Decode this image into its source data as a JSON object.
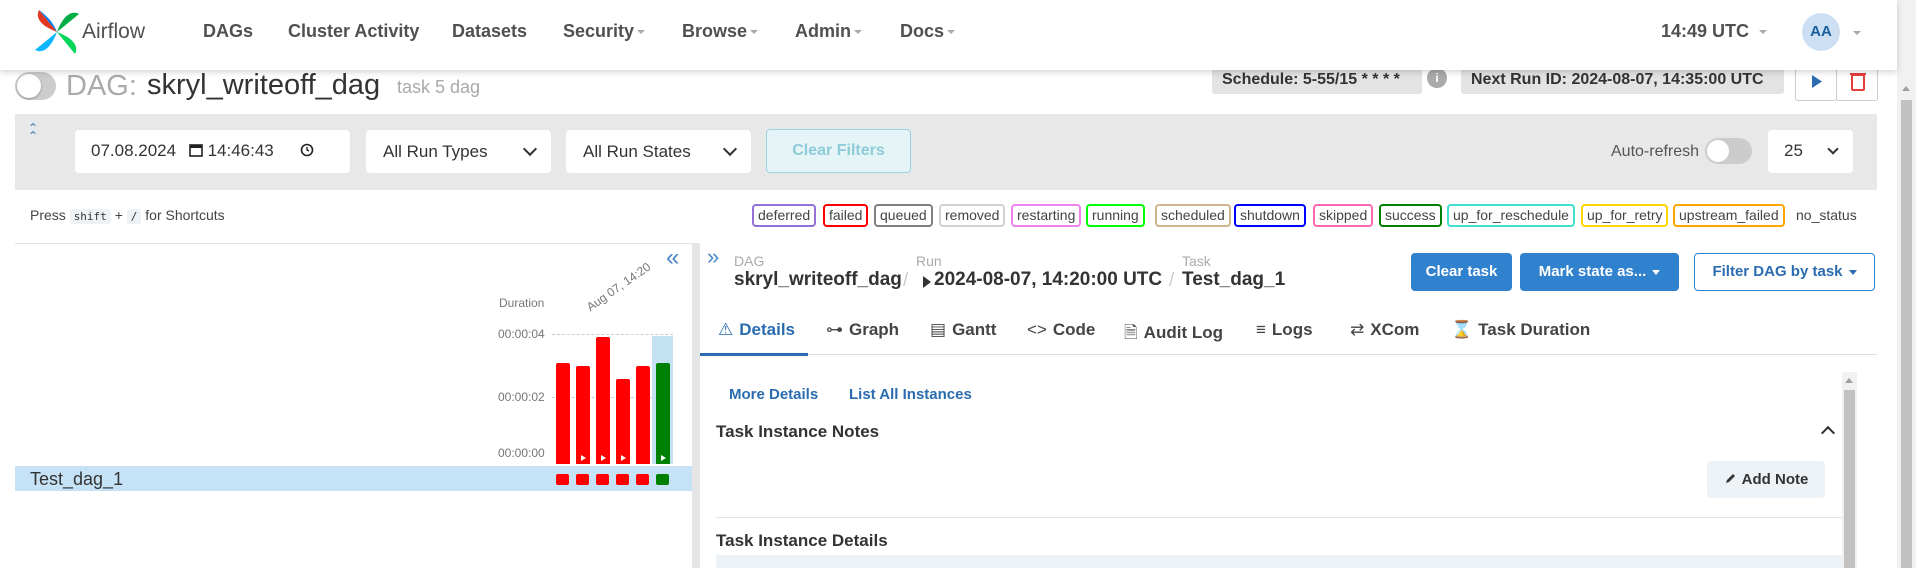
{
  "navbar": {
    "brand": "Airflow",
    "items": [
      {
        "label": "DAGs",
        "dropdown": false
      },
      {
        "label": "Cluster Activity",
        "dropdown": false
      },
      {
        "label": "Datasets",
        "dropdown": false
      },
      {
        "label": "Security",
        "dropdown": true
      },
      {
        "label": "Browse",
        "dropdown": true
      },
      {
        "label": "Admin",
        "dropdown": true
      },
      {
        "label": "Docs",
        "dropdown": true
      }
    ],
    "time": "14:49 UTC",
    "avatar": "AA"
  },
  "dag_header": {
    "prefix": "DAG:",
    "name": "skryl_writeoff_dag",
    "description": "task 5 dag",
    "schedule": "Schedule: 5-55/15 * * * *",
    "schedule_info_icon": "i",
    "next_run": "Next Run ID: 2024-08-07, 14:35:00 UTC",
    "is_paused": true
  },
  "filters": {
    "date": "07.08.2024",
    "time": "14:46:43",
    "run_types": "All Run Types",
    "run_states": "All Run States",
    "clear_filters": "Clear Filters",
    "auto_refresh_label": "Auto-refresh",
    "page_size": "25"
  },
  "shortcuts": {
    "press": "Press",
    "key1": "shift",
    "plus": "+",
    "key2": "/",
    "suffix": "for Shortcuts"
  },
  "legend": [
    {
      "label": "deferred",
      "color": "#9370db"
    },
    {
      "label": "failed",
      "color": "#ff0000"
    },
    {
      "label": "queued",
      "color": "#808080"
    },
    {
      "label": "removed",
      "color": "#d3d3d3"
    },
    {
      "label": "restarting",
      "color": "#ee82ee"
    },
    {
      "label": "running",
      "color": "#00ff00"
    },
    {
      "label": "scheduled",
      "color": "#d2b48c"
    },
    {
      "label": "shutdown",
      "color": "#0000ff"
    },
    {
      "label": "skipped",
      "color": "#ff69b4"
    },
    {
      "label": "success",
      "color": "#008000"
    },
    {
      "label": "up_for_reschedule",
      "color": "#40e0d0"
    },
    {
      "label": "up_for_retry",
      "color": "#ffd700"
    },
    {
      "label": "upstream_failed",
      "color": "#ffa500"
    }
  ],
  "no_status": "no_status",
  "grid": {
    "duration_label": "Duration",
    "date_label": "Aug 07, 14:20",
    "y_ticks": [
      "00:00:04",
      "00:00:02",
      "00:00:00"
    ],
    "runs": [
      {
        "duration_sec": 3.1,
        "state": "failed",
        "manual": false
      },
      {
        "duration_sec": 3.0,
        "state": "failed",
        "manual": true
      },
      {
        "duration_sec": 3.9,
        "state": "failed",
        "manual": true
      },
      {
        "duration_sec": 2.6,
        "state": "failed",
        "manual": true
      },
      {
        "duration_sec": 3.0,
        "state": "failed",
        "manual": false
      },
      {
        "duration_sec": 3.1,
        "state": "success",
        "manual": true
      }
    ],
    "task": {
      "name": "Test_dag_1",
      "states": [
        "failed",
        "failed",
        "failed",
        "failed",
        "failed",
        "success"
      ]
    },
    "state_colors": {
      "failed": "#ff0000",
      "success": "#008000"
    }
  },
  "details": {
    "breadcrumb": {
      "dag_label": "DAG",
      "dag_value": "skryl_writeoff_dag",
      "run_label": "Run",
      "run_value": "2024-08-07, 14:20:00 UTC",
      "task_label": "Task",
      "task_value": "Test_dag_1",
      "separator": "/"
    },
    "buttons": {
      "clear_task": "Clear task",
      "mark_state": "Mark state as...",
      "filter_dag": "Filter DAG by task"
    },
    "tabs": [
      {
        "label": "Details",
        "icon": "⚠"
      },
      {
        "label": "Graph",
        "icon": "⊶"
      },
      {
        "label": "Gantt",
        "icon": "▤"
      },
      {
        "label": "Code",
        "icon": "<>"
      },
      {
        "label": "Audit Log",
        "icon": "🗎"
      },
      {
        "label": "Logs",
        "icon": "≡"
      },
      {
        "label": "XCom",
        "icon": "⇄"
      },
      {
        "label": "Task Duration",
        "icon": "⌛"
      }
    ],
    "links": {
      "more_details": "More Details",
      "list_instances": "List All Instances"
    },
    "notes_title": "Task Instance Notes",
    "add_note": "Add Note",
    "details_title": "Task Instance Details"
  }
}
